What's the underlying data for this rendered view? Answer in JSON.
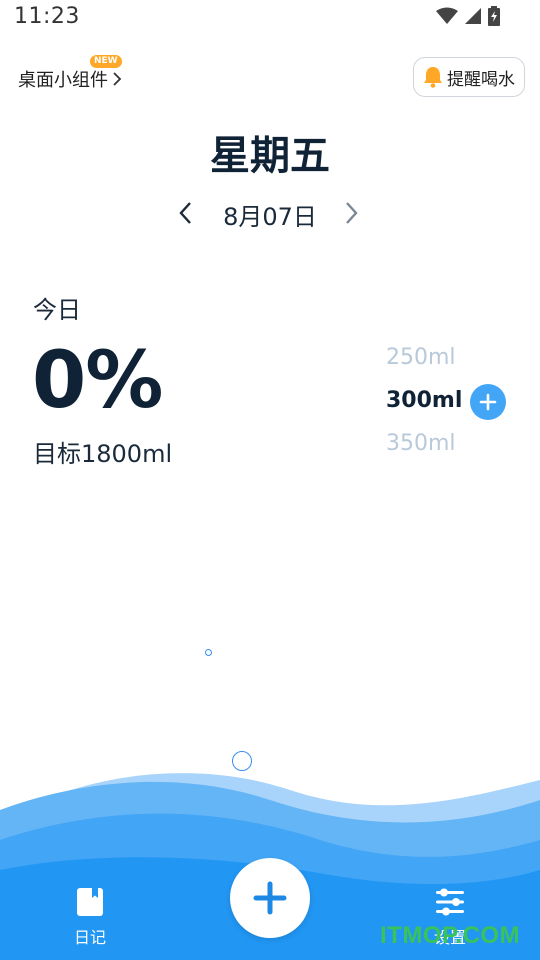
{
  "status_bar": {
    "time": "11:23"
  },
  "header": {
    "widget_link_label": "桌面小组件",
    "new_badge": "NEW",
    "reminder_label": "提醒喝水"
  },
  "day": {
    "weekday": "星期五",
    "date": "8月07日"
  },
  "progress": {
    "today_label": "今日",
    "percent": "0%",
    "goal": "目标1800ml"
  },
  "volume_picker": {
    "options": [
      "250ml",
      "300ml",
      "350ml"
    ],
    "selected": "300ml"
  },
  "bottom_nav": {
    "diary_label": "日记",
    "settings_label": "设置"
  },
  "watermark": "ITMOP.COM",
  "colors": {
    "accent": "#42a5f5",
    "wave_dark": "#2196f3",
    "wave_light": "#64b5f6",
    "text_dark": "#0f2236",
    "muted": "#b8c9d9"
  }
}
